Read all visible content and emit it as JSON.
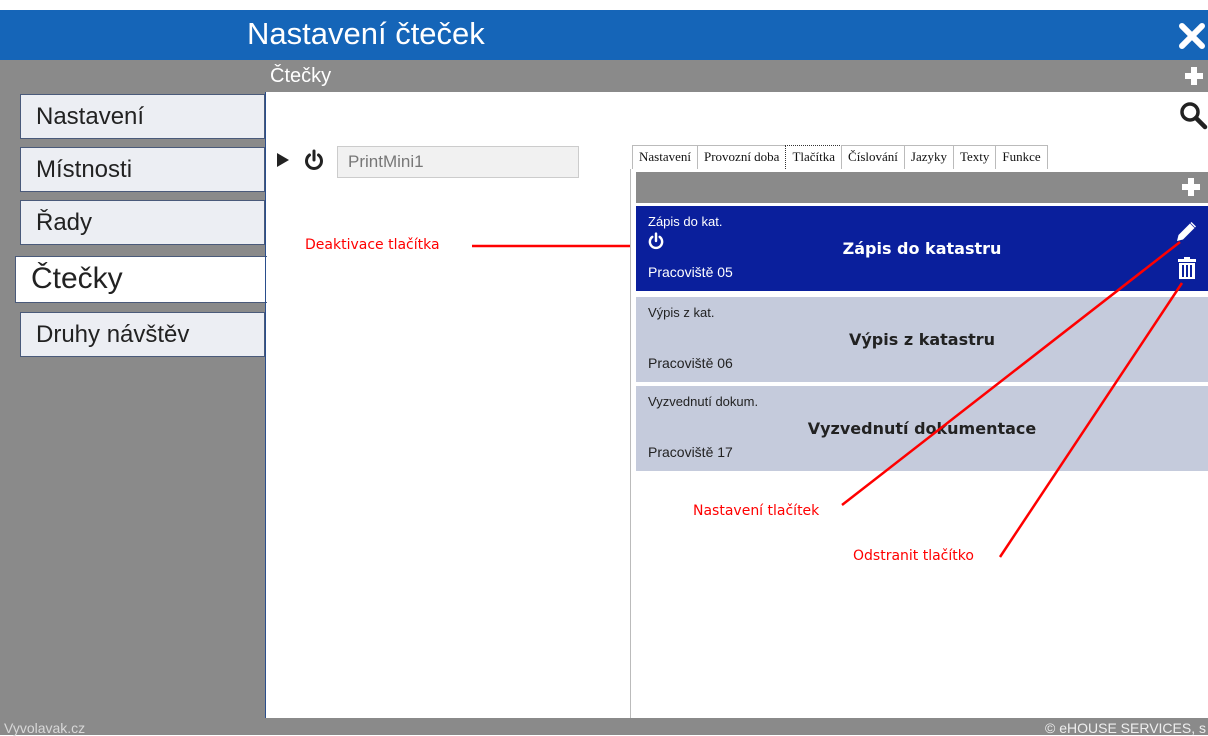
{
  "window": {
    "title": "Nastavení čteček",
    "close_icon": "close-icon"
  },
  "section": {
    "title": "Čtečky",
    "add_icon": "plus-icon"
  },
  "sidebar": {
    "items": [
      {
        "label": "Nastavení",
        "active": false
      },
      {
        "label": "Místnosti",
        "active": false
      },
      {
        "label": "Řady",
        "active": false
      },
      {
        "label": "Čtečky",
        "active": true
      },
      {
        "label": "Druhy návštěv",
        "active": false
      }
    ]
  },
  "reader": {
    "name": "PrintMini1",
    "expand_icon": "play-icon",
    "power_icon": "power-icon"
  },
  "tabs": [
    {
      "label": "Nastavení",
      "active": false
    },
    {
      "label": "Provozní doba",
      "active": false
    },
    {
      "label": "Tlačítka",
      "active": true
    },
    {
      "label": "Číslování",
      "active": false
    },
    {
      "label": "Jazyky",
      "active": false
    },
    {
      "label": "Texty",
      "active": false
    },
    {
      "label": "Funkce",
      "active": false
    }
  ],
  "buttons_list": [
    {
      "short": "Zápis do kat.",
      "label": "Zápis do katastru",
      "place": "Pracoviště 05",
      "selected": true
    },
    {
      "short": "Výpis z kat.",
      "label": "Výpis z katastru",
      "place": "Pracoviště 06",
      "selected": false
    },
    {
      "short": "Vyzvednutí dokum.",
      "label": "Vyzvednutí dokumentace",
      "place": "Pracoviště 17",
      "selected": false
    }
  ],
  "annotations": {
    "deactivate": "Deaktivace tlačítka",
    "settings": "Nastavení tlačítek",
    "remove": "Odstranit tlačítko"
  },
  "footer": {
    "left": "Vyvolavak.cz",
    "right": "© eHOUSE SERVICES, s"
  },
  "colors": {
    "title_bar": "#1565b8",
    "selected_card": "#0a1f9c",
    "card": "#c5cbdc",
    "gray_bar": "#8a8a8a",
    "annotation": "#ff0000"
  }
}
